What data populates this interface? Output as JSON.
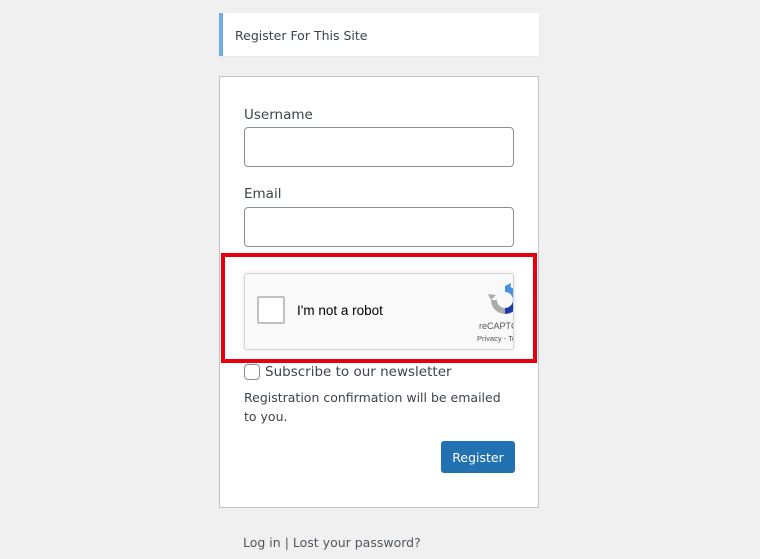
{
  "message": {
    "text": "Register For This Site"
  },
  "form": {
    "username_label": "Username",
    "username_value": "",
    "email_label": "Email",
    "email_value": "",
    "recaptcha": {
      "label": "I'm not a robot",
      "brand": "reCAPTCHA",
      "terms": "Privacy - Terms",
      "checked": false
    },
    "newsletter_label": "Subscribe to our newsletter",
    "newsletter_checked": false,
    "confirmation_note": "Registration confirmation will be emailed to you.",
    "register_label": "Register"
  },
  "nav": {
    "login": "Log in",
    "separator": "|",
    "lost_password": "Lost your password?"
  },
  "colors": {
    "background": "#f0f0f1",
    "message_accent": "#72aee6",
    "button": "#2271b1",
    "highlight": "#e9000c"
  },
  "icons": {
    "recaptcha_logo": "recaptcha-logo-icon"
  }
}
